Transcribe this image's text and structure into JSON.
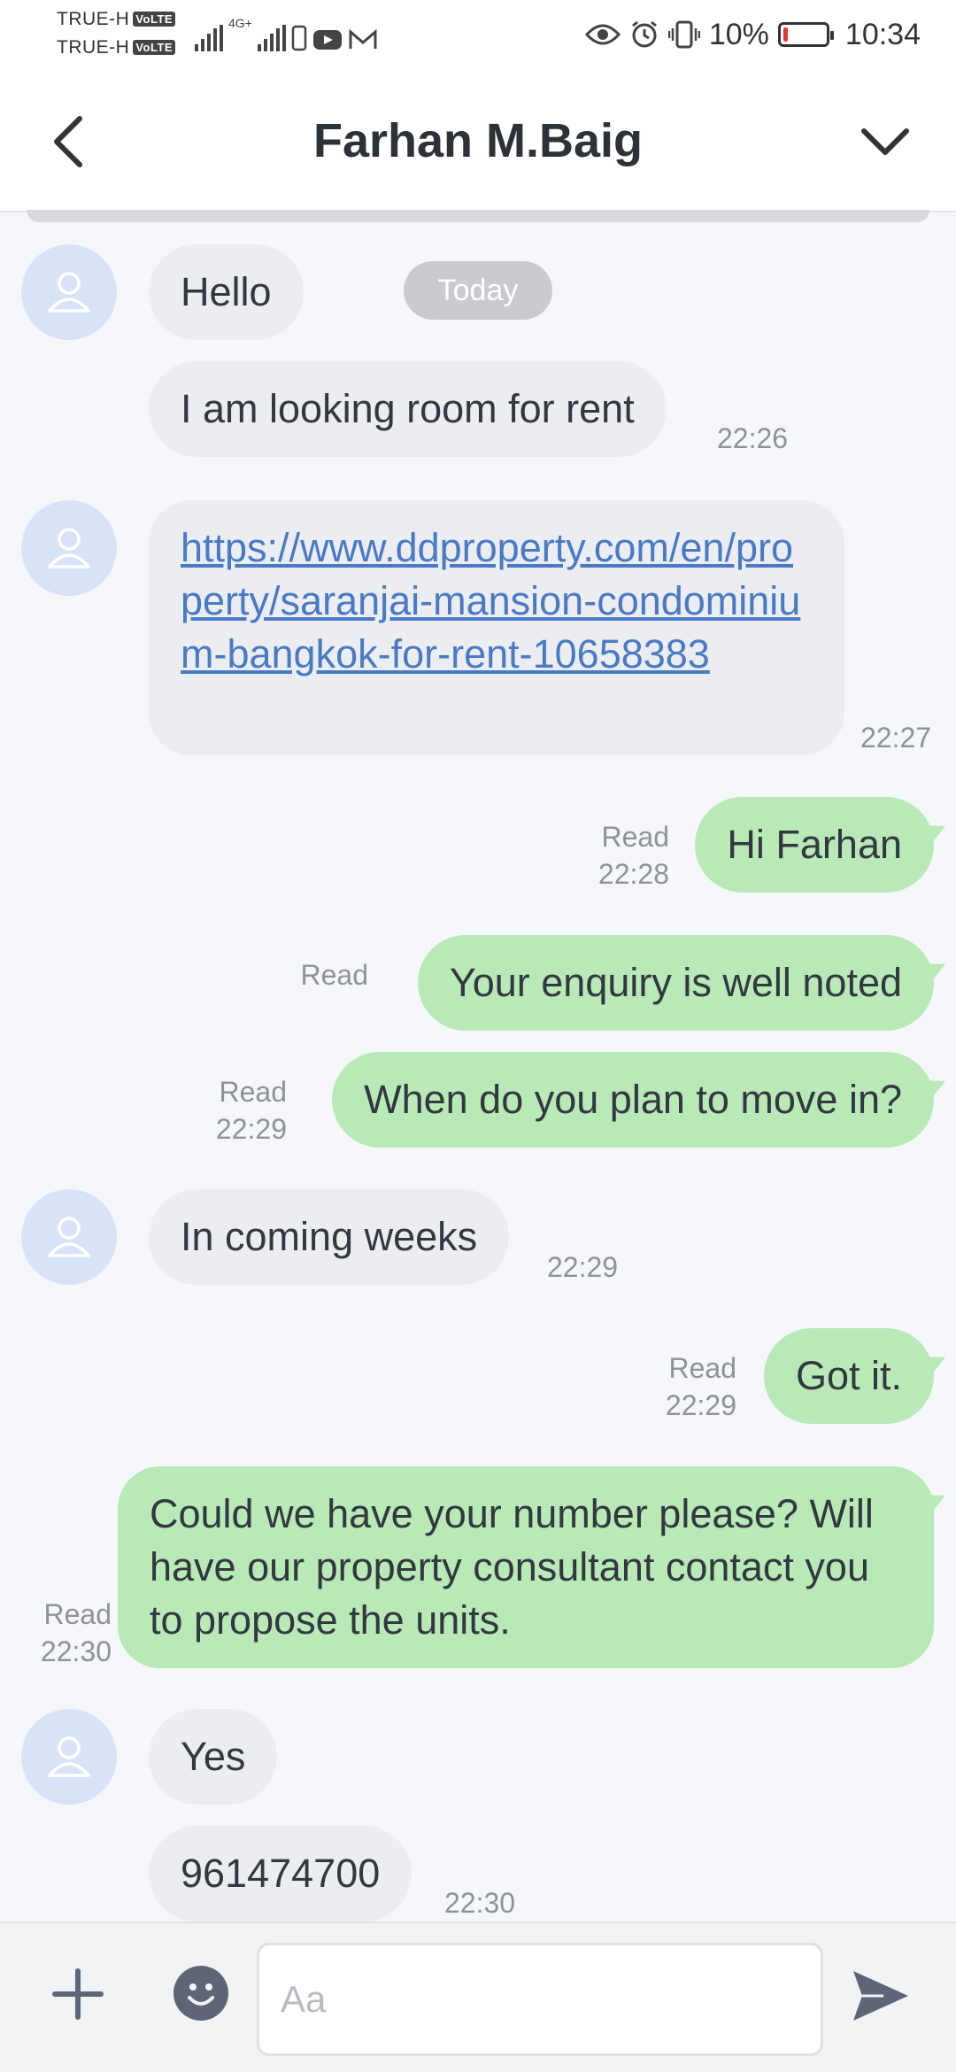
{
  "status_bar": {
    "carrier1": "TRUE-H",
    "carrier2": "TRUE-H",
    "volte": "VoLTE",
    "network": "4G+",
    "battery_percent": "10%",
    "battery_level": 0.1,
    "time": "10:34"
  },
  "header": {
    "title": "Farhan M.Baig"
  },
  "chat": {
    "date_divider": "Today",
    "messages": [
      {
        "dir": "in",
        "text": "Hello"
      },
      {
        "dir": "in",
        "text": "I am looking room for rent",
        "time": "22:26"
      },
      {
        "dir": "in",
        "link": "https://www.ddproperty.com/en/property/saranjai-mansion-condominium-bangkok-for-rent-10658383",
        "time": "22:27"
      },
      {
        "dir": "out",
        "text": "Hi Farhan",
        "status": "Read",
        "time": "22:28"
      },
      {
        "dir": "out",
        "text": "Your enquiry is well noted",
        "status": "Read"
      },
      {
        "dir": "out",
        "text": "When do you plan to move in?",
        "status": "Read",
        "time": "22:29"
      },
      {
        "dir": "in",
        "text": "In coming weeks",
        "time": "22:29"
      },
      {
        "dir": "out",
        "text": "Got it.",
        "status": "Read",
        "time": "22:29"
      },
      {
        "dir": "out",
        "text": "Could we have your number please? Will have our property consultant contact you to propose the units.",
        "status": "Read",
        "time": "22:30"
      },
      {
        "dir": "in",
        "text": "Yes"
      },
      {
        "dir": "in",
        "text": "961474700",
        "time": "22:30"
      }
    ]
  },
  "composer": {
    "placeholder": "Aa"
  },
  "colors": {
    "incoming_bubble": "#ebedf0",
    "outgoing_bubble": "#b8e9b6",
    "link": "#4a7ac4",
    "avatar_bg": "#d9e3f8"
  }
}
